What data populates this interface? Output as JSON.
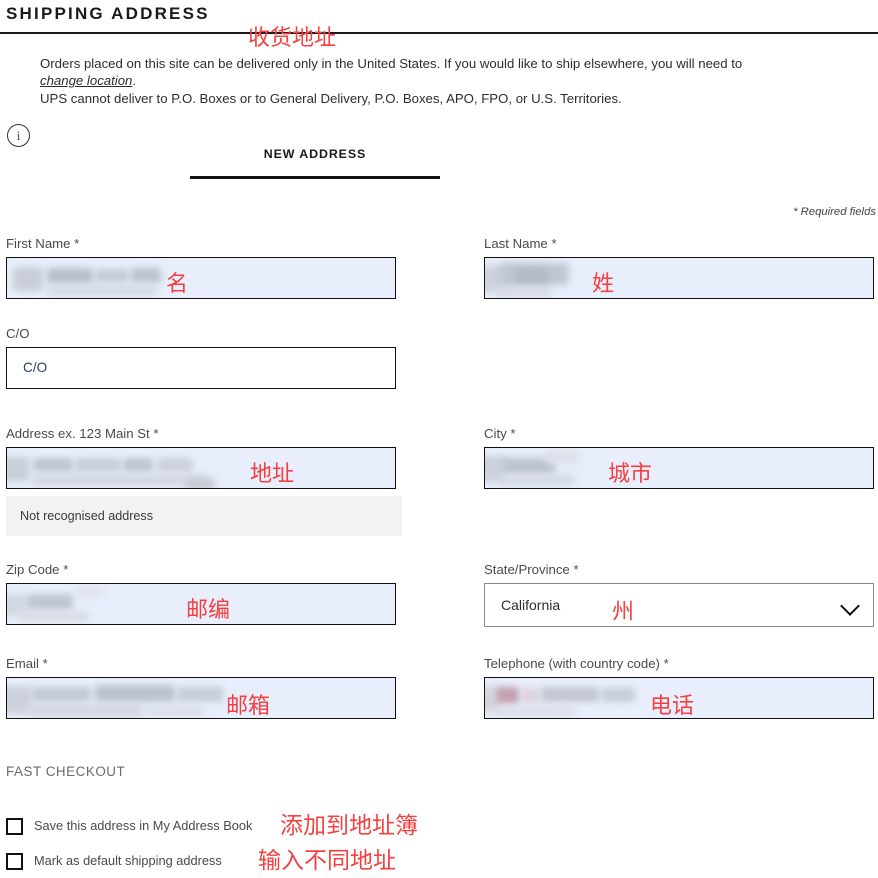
{
  "header": {
    "title": "SHIPPING ADDRESS",
    "annotation": "收货地址"
  },
  "info": {
    "icon": "info-icon",
    "line1_before": "Orders placed on this site can be delivered only in the United States. If you would like to ship elsewhere, you will need to",
    "link": "change location",
    "line1_after": ".",
    "line2": "UPS cannot deliver to P.O. Boxes or to General Delivery, P.O. Boxes, APO, FPO, or U.S. Territories."
  },
  "tabs": [
    {
      "label": "NEW ADDRESS",
      "active": true
    }
  ],
  "required_note": "* Required fields",
  "form": {
    "first_name": {
      "label": "First Name",
      "required_mark": "*",
      "value": "",
      "state": "autofilled-redacted",
      "annotation": "名"
    },
    "last_name": {
      "label": "Last Name",
      "required_mark": "*",
      "value": "",
      "state": "autofilled-redacted",
      "annotation": "姓"
    },
    "co": {
      "label": "C/O",
      "required_mark": "",
      "placeholder": "C/O",
      "value": "",
      "state": "empty"
    },
    "address": {
      "label": "Address ex. 123 Main St",
      "required_mark": "*",
      "value": "",
      "state": "autofilled-redacted",
      "annotation": "地址",
      "suggestion": "Not recognised address"
    },
    "city": {
      "label": "City",
      "required_mark": "*",
      "value": "",
      "state": "autofilled-redacted",
      "annotation": "城市"
    },
    "zip": {
      "label": "Zip Code",
      "required_mark": "*",
      "value": "",
      "state": "autofilled-redacted",
      "annotation": "邮编"
    },
    "state_province": {
      "label": "State/Province",
      "required_mark": "*",
      "value": "California",
      "icon": "chevron-down-icon",
      "annotation": "州"
    },
    "email": {
      "label": "Email",
      "required_mark": "*",
      "value": "",
      "state": "autofilled-redacted",
      "annotation": "邮箱"
    },
    "telephone": {
      "label": "Telephone (with country code)",
      "required_mark": "*",
      "value": "",
      "state": "autofilled-redacted",
      "annotation": "电话"
    }
  },
  "fast_checkout": {
    "title": "FAST CHECKOUT",
    "options": [
      {
        "label": "Save this address in My Address Book",
        "checked": false,
        "annotation": "添加到地址簿"
      },
      {
        "label": "Mark as default shipping address",
        "checked": false,
        "annotation": "输入不同地址"
      }
    ]
  },
  "colors": {
    "autofill_bg": "#e8eefb",
    "annotation": "#f44040",
    "border": "#111111",
    "suggest_bg": "#f2f2f2"
  }
}
